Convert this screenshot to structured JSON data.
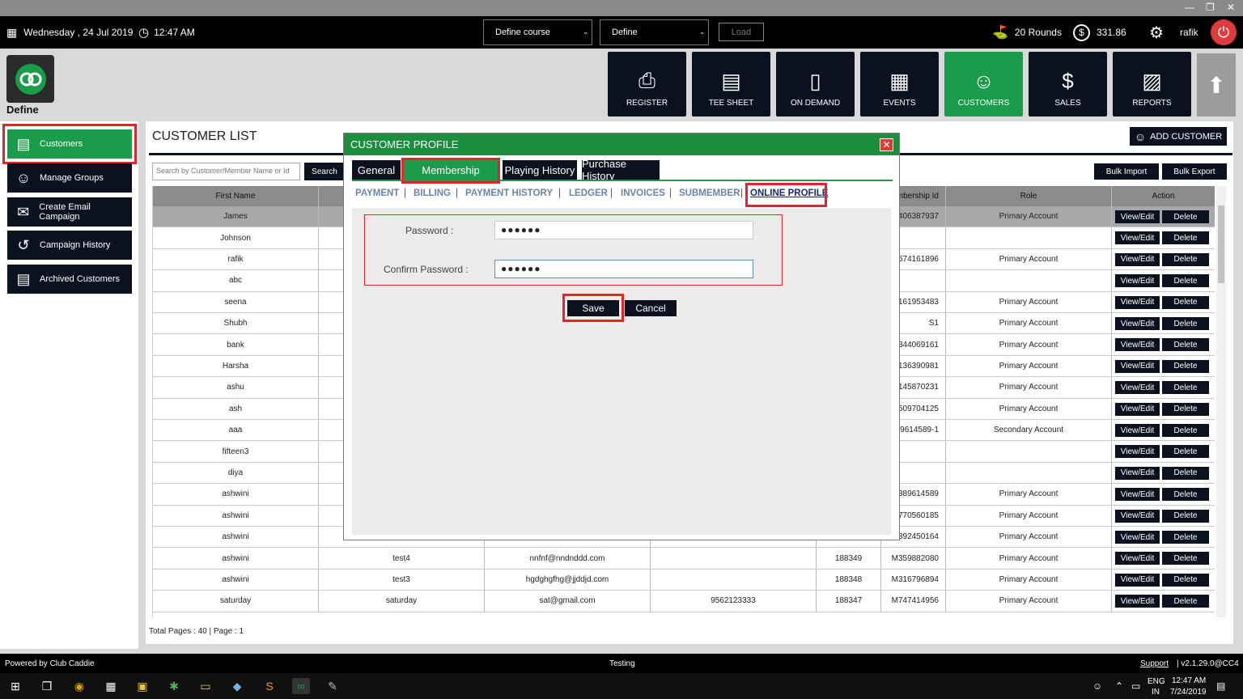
{
  "window": {
    "min": "—",
    "max": "❐",
    "close": "✕"
  },
  "topbar": {
    "date": "Wednesday , 24 Jul 2019",
    "time": "12:47 AM",
    "course_select": "Define course",
    "define_select": "Define",
    "load_label": "Load",
    "rounds": "20 Rounds",
    "balance": "331.86",
    "user": "rafik"
  },
  "app": {
    "name": "Define"
  },
  "nav": [
    {
      "label": "REGISTER",
      "icon": "barcode-scanner-icon"
    },
    {
      "label": "TEE SHEET",
      "icon": "clipboard-icon"
    },
    {
      "label": "ON DEMAND",
      "icon": "mobile-icon"
    },
    {
      "label": "EVENTS",
      "icon": "calendar-icon"
    },
    {
      "label": "CUSTOMERS",
      "icon": "users-icon"
    },
    {
      "label": "SALES",
      "icon": "money-icon"
    },
    {
      "label": "REPORTS",
      "icon": "report-icon"
    }
  ],
  "sidebar": [
    {
      "label": "Customers"
    },
    {
      "label": "Manage Groups"
    },
    {
      "label": "Create Email Campaign"
    },
    {
      "label": "Campaign History"
    },
    {
      "label": "Archived Customers"
    }
  ],
  "customer_list": {
    "title": "CUSTOMER LIST",
    "add_customer": "ADD CUSTOMER",
    "search_placeholder": "Search by Customer/Member Name or Id",
    "search_label": "Search",
    "bulk_import": "Bulk Import",
    "bulk_export": "Bulk Export",
    "headers": [
      "First Name",
      "",
      "",
      "",
      "",
      "Membership Id",
      "Role",
      "Action"
    ],
    "view_edit": "View/Edit",
    "delete": "Delete",
    "rows": [
      {
        "first": "James",
        "last": "",
        "email": "",
        "phone": "",
        "id": "",
        "membership": "M406387937",
        "role": "Primary Account"
      },
      {
        "first": "Johnson",
        "last": "",
        "email": "",
        "phone": "",
        "id": "",
        "membership": "",
        "role": ""
      },
      {
        "first": "rafik",
        "last": "",
        "email": "",
        "phone": "",
        "id": "",
        "membership": "M574161896",
        "role": "Primary Account"
      },
      {
        "first": "abc",
        "last": "",
        "email": "",
        "phone": "",
        "id": "",
        "membership": "",
        "role": ""
      },
      {
        "first": "seena",
        "last": "",
        "email": "",
        "phone": "",
        "id": "",
        "membership": "M161953483",
        "role": "Primary Account"
      },
      {
        "first": "Shubh",
        "last": "",
        "email": "",
        "phone": "",
        "id": "",
        "membership": "S1",
        "role": "Primary Account"
      },
      {
        "first": "bank",
        "last": "",
        "email": "",
        "phone": "",
        "id": "",
        "membership": "M344069161",
        "role": "Primary Account"
      },
      {
        "first": "Harsha",
        "last": "",
        "email": "",
        "phone": "",
        "id": "",
        "membership": "M136390981",
        "role": "Primary Account"
      },
      {
        "first": "ashu",
        "last": "",
        "email": "",
        "phone": "",
        "id": "",
        "membership": "M145870231",
        "role": "Primary Account"
      },
      {
        "first": "ash",
        "last": "",
        "email": "",
        "phone": "",
        "id": "",
        "membership": "M509704125",
        "role": "Primary Account"
      },
      {
        "first": "aaa",
        "last": "",
        "email": "",
        "phone": "",
        "id": "",
        "membership": "M389614589-1",
        "role": "Secondary Account"
      },
      {
        "first": "fifteen3",
        "last": "",
        "email": "",
        "phone": "",
        "id": "",
        "membership": "",
        "role": ""
      },
      {
        "first": "diya",
        "last": "",
        "email": "",
        "phone": "",
        "id": "",
        "membership": "",
        "role": ""
      },
      {
        "first": "ashwini",
        "last": "",
        "email": "",
        "phone": "",
        "id": "",
        "membership": "M389614589",
        "role": "Primary Account"
      },
      {
        "first": "ashwini",
        "last": "",
        "email": "",
        "phone": "",
        "id": "",
        "membership": "M770560185",
        "role": "Primary Account"
      },
      {
        "first": "ashwini",
        "last": "",
        "email": "",
        "phone": "",
        "id": "",
        "membership": "M392450164",
        "role": "Primary Account"
      },
      {
        "first": "ashwini",
        "last": "test4",
        "email": "nnfnf@nndnddd.com",
        "phone": "",
        "id": "188349",
        "membership": "M359882080",
        "role": "Primary Account"
      },
      {
        "first": "ashwini",
        "last": "test3",
        "email": "hgdghgfhg@jjddjd.com",
        "phone": "",
        "id": "188348",
        "membership": "M316796894",
        "role": "Primary Account"
      },
      {
        "first": "saturday",
        "last": "saturday",
        "email": "sat@gmail.com",
        "phone": "9562123333",
        "id": "188347",
        "membership": "M747414956",
        "role": "Primary Account"
      }
    ],
    "total_pages": "Total Pages : 40 | Page : 1"
  },
  "modal": {
    "title": "CUSTOMER PROFILE",
    "close": "✕",
    "tabs": [
      "General",
      "Membership",
      "Playing History",
      "Purchase History"
    ],
    "subtabs": [
      "PAYMENT",
      "BILLING",
      "PAYMENT HISTORY",
      "LEDGER",
      "INVOICES",
      "SUBMEMBER",
      "ONLINE PROFILE"
    ],
    "password_label": "Password :",
    "password_value": "●●●●●●",
    "confirm_label": "Confirm Password :",
    "confirm_value": "●●●●●●",
    "save": "Save",
    "cancel": "Cancel"
  },
  "footer": {
    "powered": "Powered by Club Caddie",
    "env": "Testing",
    "support": "Support",
    "version": "| v2.1.29.0@CC4"
  },
  "taskbar": {
    "lang1": "ENG",
    "lang2": "IN",
    "time": "12:47 AM",
    "date": "7/24/2019"
  },
  "colors": {
    "accent_green": "#1b9c4a",
    "navy": "#0c1120",
    "highlight_red": "#e3252b"
  }
}
